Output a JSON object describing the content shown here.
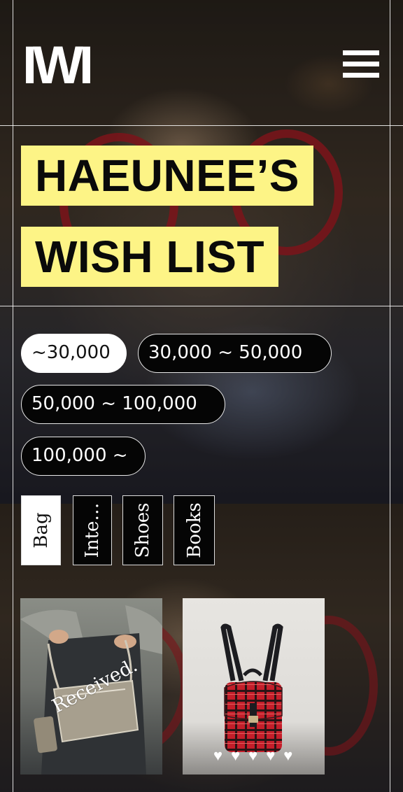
{
  "header": {
    "logo": "IWI",
    "menu_icon": "hamburger-menu-icon"
  },
  "title": {
    "line1": "HAEUNEE’S",
    "line2": "WISH LIST"
  },
  "price_filters": [
    {
      "label": "~30,000",
      "active": true
    },
    {
      "label": "30,000 ~ 50,000",
      "active": false
    },
    {
      "label": "50,000 ~ 100,000",
      "active": false
    },
    {
      "label": "100,000 ~",
      "active": false
    }
  ],
  "categories": [
    {
      "label": "Bag",
      "active": true
    },
    {
      "label": "Inte…",
      "active": false
    },
    {
      "label": "Shoes",
      "active": false
    },
    {
      "label": "Books",
      "active": false
    }
  ],
  "products": [
    {
      "badge": "Received.",
      "image_icon": "silver-bag-image"
    },
    {
      "image_icon": "red-plaid-backpack-image",
      "rating": 5,
      "heart_glyph": "♥"
    }
  ],
  "colors": {
    "title_highlight": "#fdf486",
    "pill_bg": "#050505",
    "active_bg": "#ffffff"
  }
}
